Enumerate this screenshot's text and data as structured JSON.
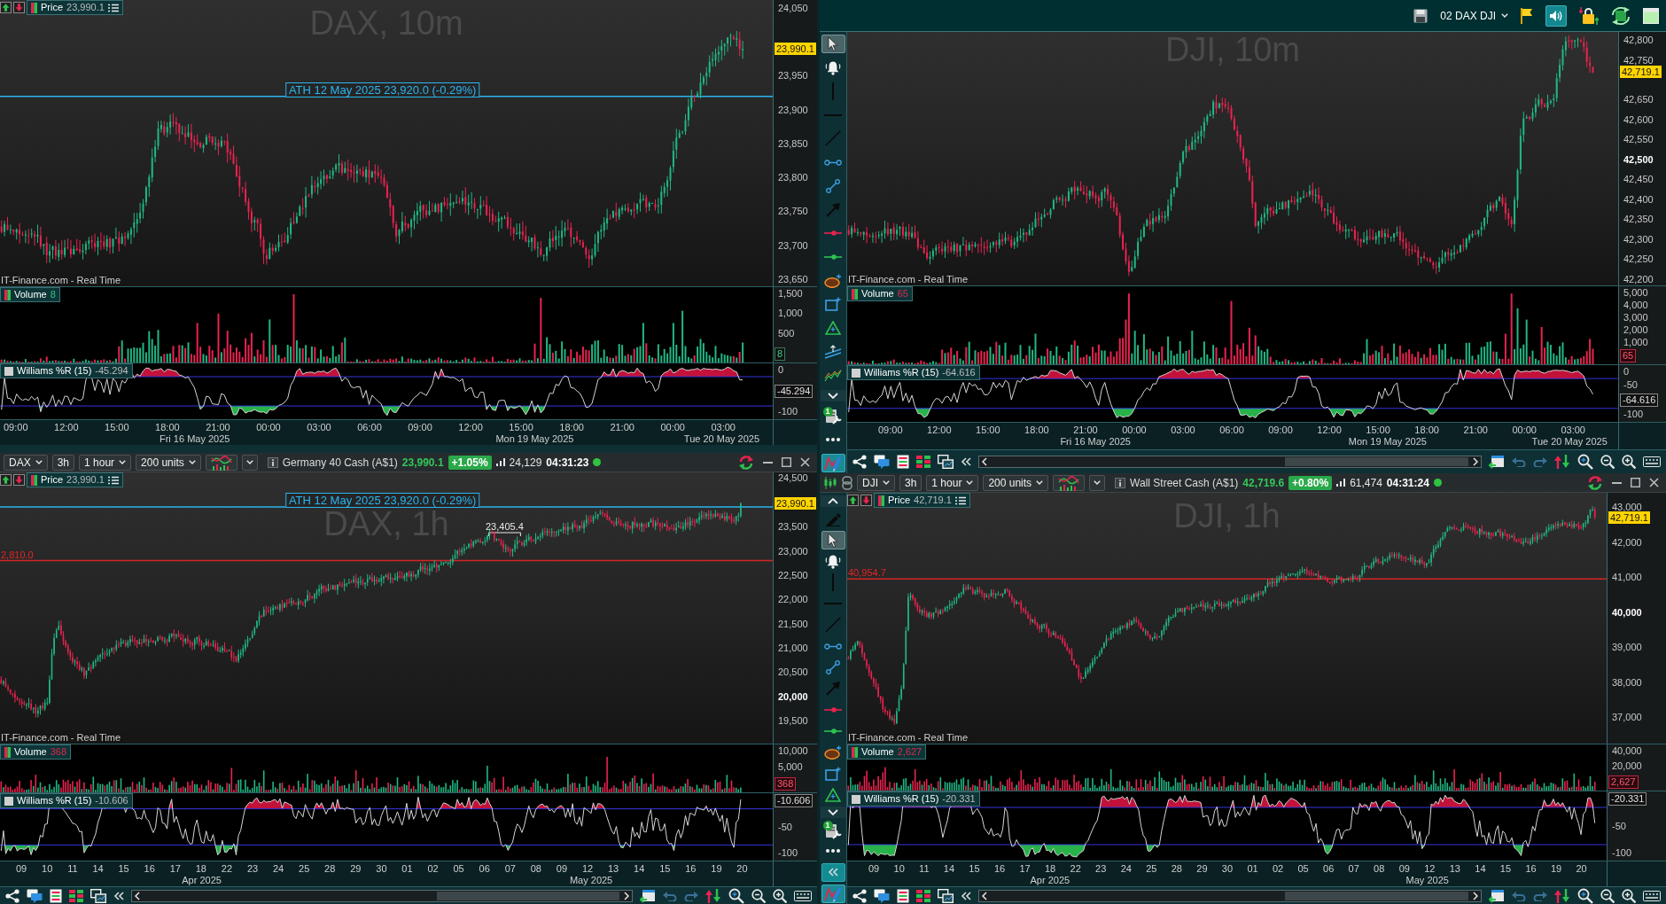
{
  "top_bar": {
    "workspace": "02 DAX DJI",
    "sound_on": true
  },
  "tool_palettes": [
    {
      "tools": [
        {
          "kind": "cursor",
          "selected": true
        },
        {
          "kind": "alert",
          "selected": false
        },
        {
          "kind": "vertical-line",
          "selected": false
        },
        {
          "kind": "horizontal-line",
          "selected": false
        },
        {
          "kind": "trend-line",
          "selected": false
        },
        {
          "kind": "segment",
          "selected": false
        },
        {
          "kind": "ray",
          "selected": false
        },
        {
          "kind": "arrow",
          "selected": false
        },
        {
          "kind": "stop-line",
          "selected": false
        },
        {
          "kind": "limit-line",
          "selected": false
        },
        {
          "kind": "ellipse",
          "selected": false
        },
        {
          "kind": "rectangle",
          "selected": false
        },
        {
          "kind": "triangle",
          "selected": false
        },
        {
          "kind": "channel",
          "selected": false
        },
        {
          "kind": "wave",
          "selected": false
        },
        {
          "kind": "expand-down",
          "selected": false
        },
        {
          "kind": "toolbox",
          "selected": false,
          "badge": "1"
        },
        {
          "kind": "more",
          "selected": false
        },
        {
          "kind": "draw",
          "selected": true
        }
      ]
    },
    {
      "tools": [
        {
          "kind": "expand-up",
          "selected": false
        },
        {
          "kind": "eraser",
          "selected": false
        },
        {
          "kind": "cursor",
          "selected": true
        },
        {
          "kind": "alert",
          "selected": false
        },
        {
          "kind": "vertical-line",
          "selected": false
        },
        {
          "kind": "horizontal-line",
          "selected": false
        },
        {
          "kind": "trend-line",
          "selected": false
        },
        {
          "kind": "segment",
          "selected": false
        },
        {
          "kind": "ray",
          "selected": false
        },
        {
          "kind": "arrow",
          "selected": false
        },
        {
          "kind": "stop-line",
          "selected": false
        },
        {
          "kind": "limit-line",
          "selected": false
        },
        {
          "kind": "ellipse",
          "selected": false
        },
        {
          "kind": "rectangle",
          "selected": false
        },
        {
          "kind": "triangle",
          "selected": false
        },
        {
          "kind": "expand-down",
          "selected": false
        },
        {
          "kind": "toolbox",
          "selected": false,
          "badge": "1"
        },
        {
          "kind": "more",
          "selected": false
        },
        {
          "kind": "collapse",
          "selected": true
        },
        {
          "kind": "draw",
          "selected": true
        }
      ]
    }
  ],
  "windows": [
    {
      "chart": {
        "title": "DAX, 10m",
        "legend": {
          "label": "Price",
          "value": "23,990.1"
        },
        "price_axis": [
          {
            "text": "24,050",
            "major": false
          },
          {
            "text": "23,950",
            "major": false
          },
          {
            "text": "23,900",
            "major": false
          },
          {
            "text": "23,850",
            "major": false
          },
          {
            "text": "23,800",
            "major": false
          },
          {
            "text": "23,750",
            "major": false
          },
          {
            "text": "23,700",
            "major": false
          },
          {
            "text": "23,650",
            "major": false
          }
        ],
        "last_price": "23,990.1",
        "lines": [
          {
            "kind": "ath",
            "label": "ATH 12 May 2025 23,920.0 (-0.29%)"
          }
        ],
        "source": "IT-Finance.com - Real Time",
        "volume": {
          "label": "Volume",
          "value": "8",
          "rising": true,
          "axis": [
            {
              "kind": "tick",
              "text": "1,500"
            },
            {
              "kind": "tick",
              "text": "1,000"
            },
            {
              "kind": "tick",
              "text": "500"
            },
            {
              "kind": "last",
              "text": "8"
            }
          ]
        },
        "williams": {
          "label": "Williams %R (15)",
          "value": "-45.294",
          "axis": [
            {
              "kind": "tick",
              "text": "0"
            },
            {
              "kind": "last",
              "text": "-45.294"
            },
            {
              "kind": "tick",
              "text": "-100"
            }
          ]
        },
        "time_axis": {
          "ticks": [
            "09:00",
            "12:00",
            "15:00",
            "18:00",
            "21:00",
            "00:00",
            "03:00",
            "06:00",
            "09:00",
            "12:00",
            "15:00",
            "18:00",
            "21:00",
            "00:00",
            "03:00"
          ],
          "dates": [
            "Fri 16 May 2025",
            "Mon 19 May 2025",
            "Tue 20 May 2025"
          ]
        }
      }
    },
    {
      "chart": {
        "title": "DJI, 10m",
        "price_axis": [
          {
            "text": "42,800",
            "major": false
          },
          {
            "text": "42,750",
            "major": false
          },
          {
            "text": "42,650",
            "major": false
          },
          {
            "text": "42,600",
            "major": false
          },
          {
            "text": "42,550",
            "major": false
          },
          {
            "text": "42,500",
            "major": true
          },
          {
            "text": "42,450",
            "major": false
          },
          {
            "text": "42,400",
            "major": false
          },
          {
            "text": "42,350",
            "major": false
          },
          {
            "text": "42,300",
            "major": false
          },
          {
            "text": "42,250",
            "major": false
          },
          {
            "text": "42,200",
            "major": false
          }
        ],
        "last_price": "42,719.1",
        "source": "IT-Finance.com - Real Time",
        "volume": {
          "label": "Volume",
          "value": "65",
          "rising": false,
          "axis": [
            {
              "kind": "tick",
              "text": "5,000"
            },
            {
              "kind": "tick",
              "text": "4,000"
            },
            {
              "kind": "tick",
              "text": "3,000"
            },
            {
              "kind": "tick",
              "text": "2,000"
            },
            {
              "kind": "tick",
              "text": "1,000"
            },
            {
              "kind": "last",
              "text": "65"
            }
          ]
        },
        "williams": {
          "label": "Williams %R (15)",
          "value": "-64.616",
          "axis": [
            {
              "kind": "tick",
              "text": "0"
            },
            {
              "kind": "tick",
              "text": "-50"
            },
            {
              "kind": "last",
              "text": "-64.616"
            },
            {
              "kind": "tick",
              "text": "-100"
            }
          ]
        },
        "time_axis": {
          "ticks": [
            "09:00",
            "12:00",
            "15:00",
            "18:00",
            "21:00",
            "00:00",
            "03:00",
            "06:00",
            "09:00",
            "12:00",
            "15:00",
            "18:00",
            "21:00",
            "00:00",
            "03:00"
          ],
          "dates": [
            "Fri 16 May 2025",
            "Mon 19 May 2025",
            "Tue 20 May 2025"
          ]
        },
        "toolbar": {
          "left": [
            {
              "kind": "share"
            },
            {
              "kind": "chat"
            },
            {
              "kind": "report"
            },
            {
              "kind": "table"
            },
            {
              "kind": "windows"
            },
            {
              "kind": "collapse"
            }
          ],
          "right": [
            {
              "kind": "calendar"
            },
            {
              "kind": "undo"
            },
            {
              "kind": "redo"
            },
            {
              "kind": "compare"
            },
            {
              "kind": "zoom-fit"
            },
            {
              "kind": "zoom-out"
            },
            {
              "kind": "zoom-in"
            },
            {
              "kind": "menu"
            }
          ]
        }
      }
    },
    {
      "header": {
        "symbol": "DAX",
        "span": "3h",
        "interval": "1 hour",
        "units": "200 units",
        "instrument": "Germany 40 Cash (A$1)",
        "price": "23,990.1",
        "change": "+1.05%",
        "rising": true,
        "volume": "24,129",
        "time": "04:31:23",
        "live": true
      },
      "chart": {
        "title": "DAX, 1h",
        "legend": {
          "label": "Price",
          "value": "23,990.1"
        },
        "price_axis": [
          {
            "text": "24,500",
            "major": false
          },
          {
            "text": "23,500",
            "major": false
          },
          {
            "text": "23,000",
            "major": false
          },
          {
            "text": "22,500",
            "major": false
          },
          {
            "text": "22,000",
            "major": false
          },
          {
            "text": "21,500",
            "major": false
          },
          {
            "text": "21,000",
            "major": false
          },
          {
            "text": "20,500",
            "major": false
          },
          {
            "text": "20,000",
            "major": true
          },
          {
            "text": "19,500",
            "major": false
          }
        ],
        "last_price": "23,990.1",
        "lines": [
          {
            "kind": "ath",
            "label": "ATH 12 May 2025 23,920.0 (-0.29%)"
          },
          {
            "kind": "peak",
            "label": "23,405.4"
          },
          {
            "kind": "level",
            "label": "2,810.0"
          }
        ],
        "source": "IT-Finance.com - Real Time",
        "volume": {
          "label": "Volume",
          "value": "368",
          "rising": false,
          "axis": [
            {
              "kind": "tick",
              "text": "10,000"
            },
            {
              "kind": "tick",
              "text": "5,000"
            },
            {
              "kind": "last",
              "text": "368"
            }
          ]
        },
        "williams": {
          "label": "Williams %R (15)",
          "value": "-10.606",
          "axis": [
            {
              "kind": "last",
              "text": "-10.606"
            },
            {
              "kind": "tick",
              "text": "-50"
            },
            {
              "kind": "tick",
              "text": "-100"
            }
          ]
        },
        "time_axis": {
          "ticks": [
            "09",
            "10",
            "11",
            "14",
            "15",
            "16",
            "17",
            "18",
            "22",
            "23",
            "24",
            "25",
            "28",
            "29",
            "30",
            "01",
            "02",
            "05",
            "06",
            "07",
            "08",
            "09",
            "12",
            "13",
            "14",
            "15",
            "16",
            "19",
            "20"
          ],
          "dates": [
            "Apr 2025",
            "May 2025"
          ]
        },
        "toolbar": {
          "left": [
            {
              "kind": "share"
            },
            {
              "kind": "chat"
            },
            {
              "kind": "report"
            },
            {
              "kind": "table"
            },
            {
              "kind": "windows"
            },
            {
              "kind": "collapse"
            }
          ],
          "right": [
            {
              "kind": "calendar"
            },
            {
              "kind": "undo"
            },
            {
              "kind": "redo"
            },
            {
              "kind": "compare"
            },
            {
              "kind": "zoom-fit"
            },
            {
              "kind": "zoom-out"
            },
            {
              "kind": "zoom-in"
            },
            {
              "kind": "menu"
            }
          ]
        }
      }
    },
    {
      "header": {
        "lead_icons": [
          {
            "kind": "candles"
          },
          {
            "kind": "link"
          }
        ],
        "symbol": "DJI",
        "span": "3h",
        "interval": "1 hour",
        "units": "200 units",
        "instrument": "Wall Street Cash (A$1)",
        "price": "42,719.6",
        "change": "+0.80%",
        "rising": true,
        "volume": "61,474",
        "time": "04:31:24",
        "live": true
      },
      "chart": {
        "title": "DJI, 1h",
        "legend": {
          "label": "Price",
          "value": "42,719.1"
        },
        "price_axis": [
          {
            "text": "43,000",
            "major": false
          },
          {
            "text": "42,000",
            "major": false
          },
          {
            "text": "41,000",
            "major": false
          },
          {
            "text": "40,000",
            "major": true
          },
          {
            "text": "39,000",
            "major": false
          },
          {
            "text": "38,000",
            "major": false
          },
          {
            "text": "37,000",
            "major": false
          }
        ],
        "last_price": "42,719.1",
        "lines": [
          {
            "kind": "level",
            "label": "40,954.7"
          }
        ],
        "source": "IT-Finance.com - Real Time",
        "volume": {
          "label": "Volume",
          "value": "2,627",
          "rising": false,
          "axis": [
            {
              "kind": "tick",
              "text": "40,000"
            },
            {
              "kind": "tick",
              "text": "20,000"
            },
            {
              "kind": "last",
              "text": "2,627"
            }
          ]
        },
        "williams": {
          "label": "Williams %R (15)",
          "value": "-20.331",
          "axis": [
            {
              "kind": "last",
              "text": "-20.331"
            },
            {
              "kind": "tick",
              "text": "-50"
            },
            {
              "kind": "tick",
              "text": "-100"
            }
          ]
        },
        "time_axis": {
          "ticks": [
            "09",
            "10",
            "11",
            "14",
            "15",
            "16",
            "17",
            "18",
            "22",
            "23",
            "24",
            "25",
            "28",
            "29",
            "30",
            "01",
            "02",
            "05",
            "06",
            "07",
            "08",
            "09",
            "12",
            "13",
            "14",
            "15",
            "16",
            "19",
            "20"
          ],
          "dates": [
            "Apr 2025",
            "May 2025"
          ]
        },
        "toolbar": {
          "left": [
            {
              "kind": "share"
            },
            {
              "kind": "chat"
            },
            {
              "kind": "report"
            },
            {
              "kind": "table"
            },
            {
              "kind": "windows"
            },
            {
              "kind": "collapse"
            }
          ],
          "right": [
            {
              "kind": "calendar"
            },
            {
              "kind": "undo"
            },
            {
              "kind": "redo"
            },
            {
              "kind": "compare"
            },
            {
              "kind": "zoom-fit"
            },
            {
              "kind": "zoom-out"
            },
            {
              "kind": "zoom-in"
            },
            {
              "kind": "menu"
            }
          ]
        }
      }
    }
  ]
}
